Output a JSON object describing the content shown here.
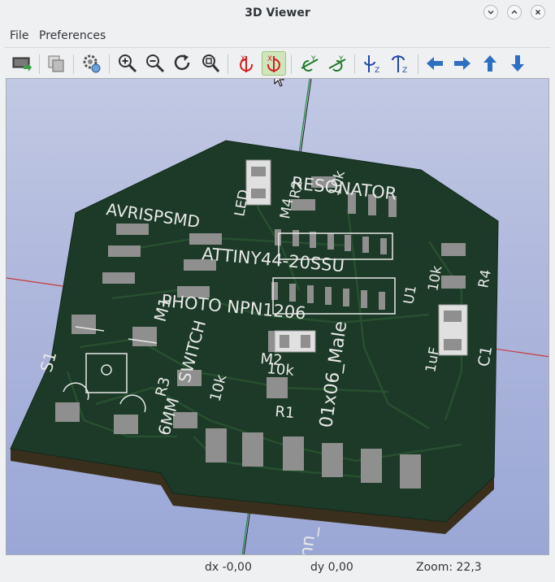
{
  "window": {
    "title": "3D Viewer"
  },
  "menu": {
    "file": "File",
    "preferences": "Preferences"
  },
  "toolbar": {
    "items": [
      {
        "name": "reload-board-button",
        "icon": "reload-board-icon"
      },
      {
        "name": "copy-to-clipboard-button",
        "icon": "copy-clipboard-icon"
      },
      {
        "name": "render-options-button",
        "icon": "render-settings-icon"
      },
      {
        "name": "zoom-in-button",
        "icon": "zoom-in-icon"
      },
      {
        "name": "zoom-out-button",
        "icon": "zoom-out-icon"
      },
      {
        "name": "redraw-button",
        "icon": "redraw-icon"
      },
      {
        "name": "zoom-fit-button",
        "icon": "zoom-fit-icon"
      },
      {
        "name": "rotate-x-cw-button",
        "icon": "rotate-x-cw-icon"
      },
      {
        "name": "rotate-x-ccw-button",
        "icon": "rotate-x-ccw-icon"
      },
      {
        "name": "rotate-y-cw-button",
        "icon": "rotate-y-cw-icon"
      },
      {
        "name": "rotate-y-ccw-button",
        "icon": "rotate-y-ccw-icon"
      },
      {
        "name": "rotate-z-cw-button",
        "icon": "rotate-z-cw-icon"
      },
      {
        "name": "rotate-z-ccw-button",
        "icon": "rotate-z-ccw-icon"
      },
      {
        "name": "move-left-button",
        "icon": "arrow-left-icon"
      },
      {
        "name": "move-right-button",
        "icon": "arrow-right-icon"
      },
      {
        "name": "move-up-button",
        "icon": "arrow-up-icon"
      },
      {
        "name": "move-down-button",
        "icon": "arrow-down-icon"
      }
    ],
    "axis_labels": {
      "x": "X",
      "y": "Y",
      "z": "Z"
    },
    "active_item": "rotate-x-ccw-button"
  },
  "board": {
    "silkscreen": [
      "AVRISPSMD",
      "RESONATOR",
      "ATTINY44-20SSU",
      "PHOTO NPN1206",
      "M1",
      "SWITCH",
      "6MM",
      "S1",
      "R3",
      "10k",
      "M2",
      "10k",
      "R1",
      "01x06_Male",
      "LED",
      "M4",
      "R2",
      "10k",
      "10k",
      "R4",
      "U1",
      "1uF",
      "C1",
      "nn_"
    ],
    "colors": {
      "board": "#1c3a27",
      "pad": "#8f8f8f",
      "silkscreen": "#e8e8e8",
      "edge": "#3a2f1c"
    }
  },
  "status": {
    "dx": "dx -0,00",
    "dy": "dy 0,00",
    "zoom": "Zoom: 22,3"
  }
}
